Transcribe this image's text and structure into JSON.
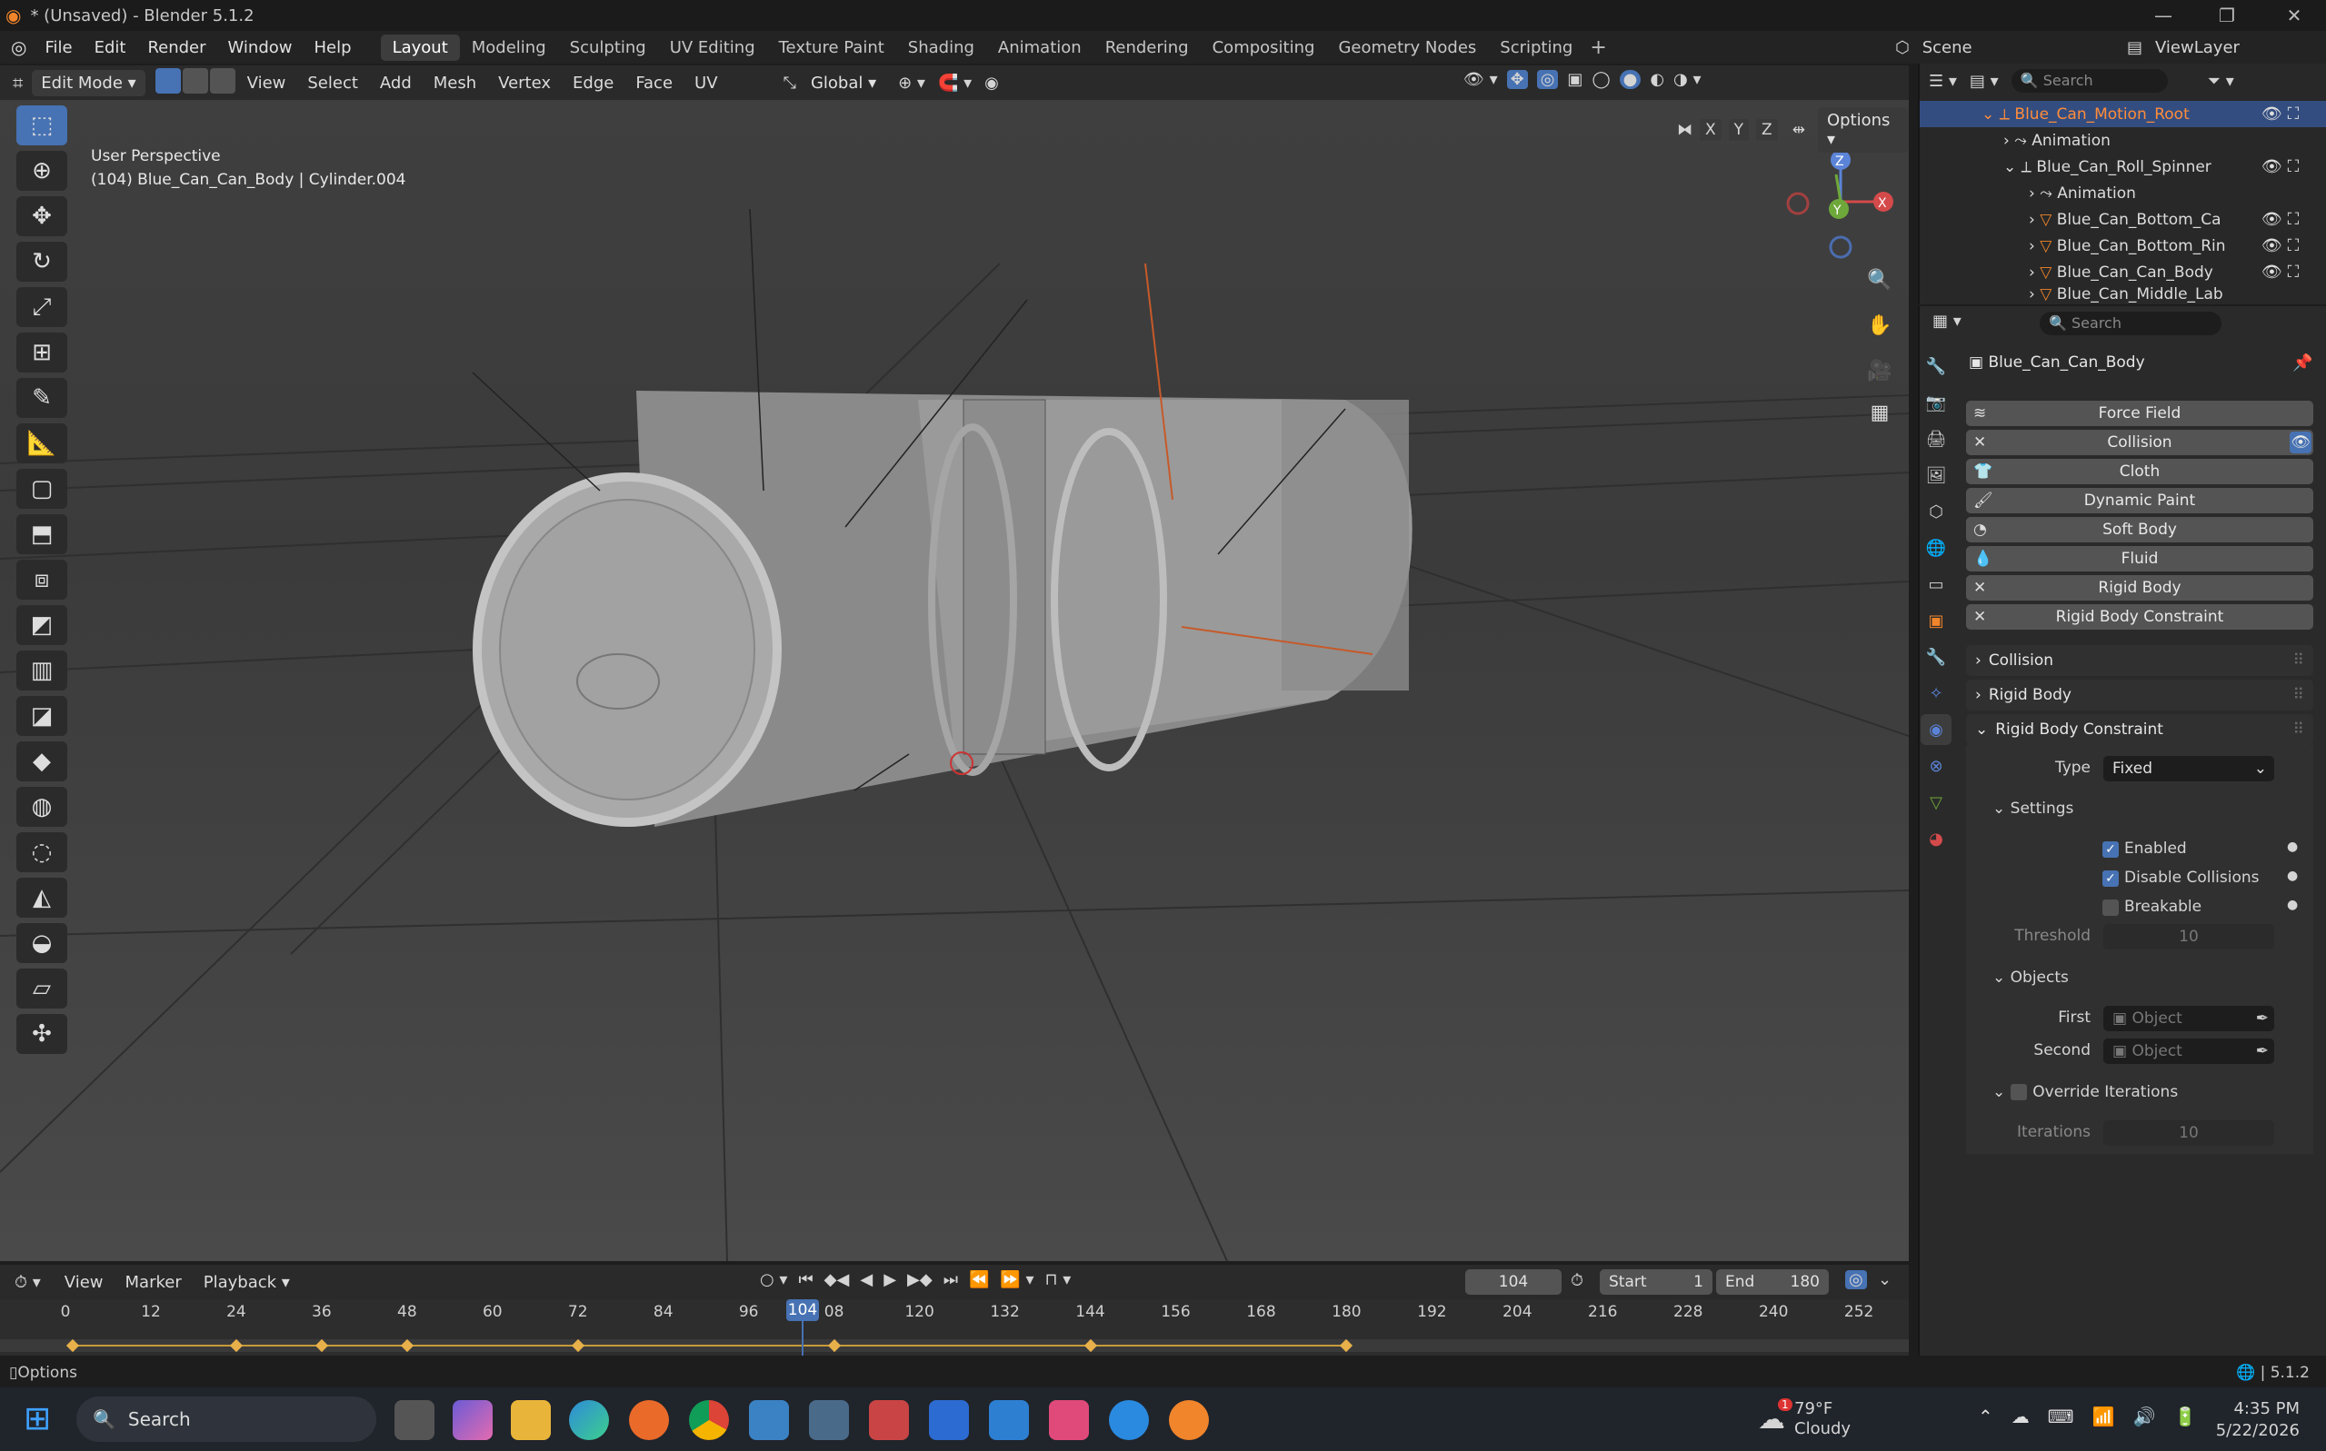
{
  "window": {
    "title": "* (Unsaved) - Blender 5.1.2"
  },
  "menu": {
    "items": [
      "File",
      "Edit",
      "Render",
      "Window",
      "Help"
    ]
  },
  "workspaces": [
    "Layout",
    "Modeling",
    "Sculpting",
    "UV Editing",
    "Texture Paint",
    "Shading",
    "Animation",
    "Rendering",
    "Compositing",
    "Geometry Nodes",
    "Scripting"
  ],
  "active_workspace": "Layout",
  "scene": {
    "scene_name": "Scene",
    "view_layer": "ViewLayer"
  },
  "viewport_header": {
    "mode": "Edit Mode",
    "menus": [
      "View",
      "Select",
      "Add",
      "Mesh",
      "Vertex",
      "Edge",
      "Face",
      "UV"
    ],
    "orientation": "Global",
    "options": "Options",
    "axes": [
      "X",
      "Y",
      "Z"
    ]
  },
  "viewport": {
    "info_line1": "User Perspective",
    "info_line2": "(104) Blue_Can_Can_Body | Cylinder.004",
    "gizmo": {
      "z": "Z",
      "y": "Y",
      "x": "X"
    }
  },
  "outliner": {
    "search_placeholder": "Search",
    "rows": [
      {
        "label": "Blue_Can_Motion_Root",
        "selected": true
      },
      {
        "label": "Animation"
      },
      {
        "label": "Blue_Can_Roll_Spinner"
      },
      {
        "label": "Animation"
      },
      {
        "label": "Blue_Can_Bottom_Ca"
      },
      {
        "label": "Blue_Can_Bottom_Rin"
      },
      {
        "label": "Blue_Can_Can_Body"
      },
      {
        "label": "Blue_Can_Middle_Lab"
      }
    ]
  },
  "properties": {
    "search_placeholder": "Search",
    "object_name": "Blue_Can_Can_Body",
    "physics_buttons": [
      {
        "label": "Force Field",
        "icon": "force-field-icon",
        "active": false
      },
      {
        "label": "Collision",
        "icon": "x-icon",
        "active": true
      },
      {
        "label": "Cloth",
        "icon": "cloth-icon",
        "active": false
      },
      {
        "label": "Dynamic Paint",
        "icon": "brush-icon",
        "active": false
      },
      {
        "label": "Soft Body",
        "icon": "softbody-icon",
        "active": false
      },
      {
        "label": "Fluid",
        "icon": "fluid-icon",
        "active": false
      },
      {
        "label": "Rigid Body",
        "icon": "x-icon",
        "active": true
      },
      {
        "label": "Rigid Body Constraint",
        "icon": "x-icon",
        "active": true
      }
    ],
    "panels": {
      "collision": "Collision",
      "rigid_body": "Rigid Body",
      "rigid_body_constraint": "Rigid Body Constraint"
    },
    "type_label": "Type",
    "type_value": "Fixed",
    "settings": {
      "title": "Settings",
      "enabled": "Enabled",
      "disable_collisions": "Disable Collisions",
      "breakable": "Breakable",
      "threshold_label": "Threshold",
      "threshold_value": "10"
    },
    "objects": {
      "title": "Objects",
      "first_label": "First",
      "second_label": "Second",
      "placeholder": "Object"
    },
    "override": {
      "title": "Override Iterations",
      "iterations_label": "Iterations",
      "iterations_value": "10"
    }
  },
  "timeline": {
    "menus": [
      "View",
      "Marker",
      "Playback"
    ],
    "current_frame": "104",
    "start_label": "Start",
    "start_value": "1",
    "end_label": "End",
    "end_value": "180",
    "ticks": [
      "0",
      "12",
      "24",
      "36",
      "48",
      "60",
      "72",
      "84",
      "96",
      "104",
      "08",
      "120",
      "132",
      "144",
      "156",
      "168",
      "180",
      "192",
      "204",
      "216",
      "228",
      "240",
      "252"
    ],
    "keyframes": [
      1,
      24,
      36,
      48,
      72,
      108,
      144,
      180
    ]
  },
  "status": {
    "left": "Options",
    "version": "5.1.2"
  },
  "taskbar": {
    "search": "Search",
    "weather_temp": "79°F",
    "weather_desc": "Cloudy",
    "weather_badge": "1",
    "time": "4:35 PM",
    "date": "5/22/2026"
  },
  "colors": {
    "accent": "#4772b3",
    "selected_text": "#ff8c3a",
    "keyframe": "#e8b04a"
  }
}
